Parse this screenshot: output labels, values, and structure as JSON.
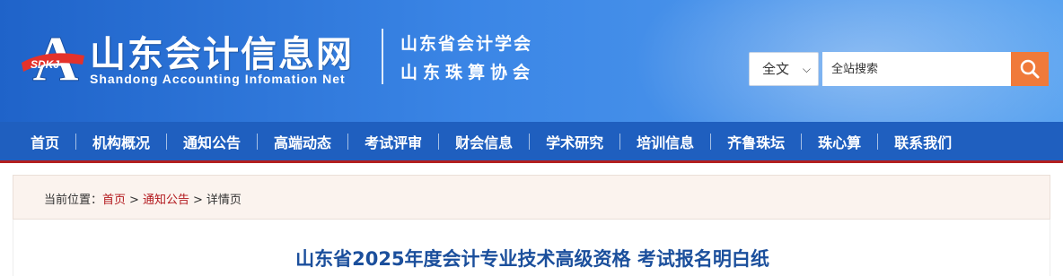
{
  "header": {
    "logo_badge": "SDKJ",
    "logo_letter": "A",
    "site_name_cn": "山东会计信息网",
    "site_name_en": "Shandong Accounting Infomation Net",
    "org_line1": "山东省会计学会",
    "org_line2": "山东珠算协会"
  },
  "search": {
    "scope_selected": "全文",
    "placeholder": "全站搜索",
    "icon": "search-icon"
  },
  "nav": {
    "items": [
      "首页",
      "机构概况",
      "通知公告",
      "高端动态",
      "考试评审",
      "财会信息",
      "学术研究",
      "培训信息",
      "齐鲁珠坛",
      "珠心算",
      "联系我们"
    ]
  },
  "breadcrumb": {
    "prefix": "当前位置：",
    "items": [
      "首页",
      "通知公告",
      "详情页"
    ],
    "separator": ">"
  },
  "article": {
    "title": "山东省2025年度会计专业技术高级资格 考试报名明白纸"
  },
  "colors": {
    "header_blue": "#1f63c9",
    "nav_blue": "#1f5fbf",
    "accent_red": "#b21f1f",
    "search_orange": "#f07a3a",
    "title_blue": "#1b4f9c"
  }
}
